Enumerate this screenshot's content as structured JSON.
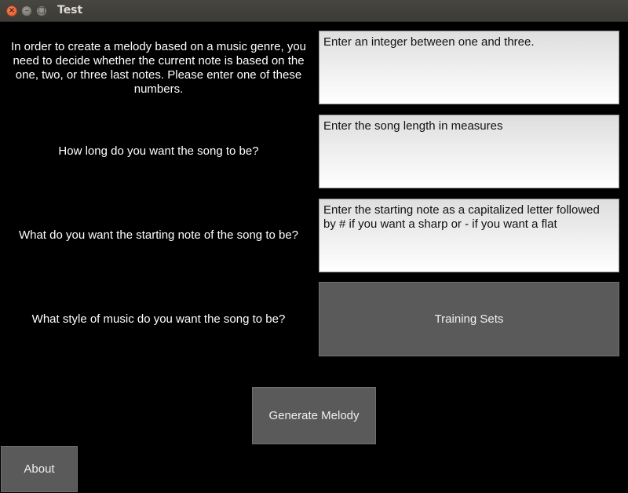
{
  "window": {
    "title": "Test",
    "close_glyph": "×",
    "minimize_glyph": "–",
    "maximize_glyph": "□"
  },
  "form": {
    "rows": [
      {
        "label": "In order to create a melody based on a music genre, you need to decide whether the current note is based on the one, two, or three last notes. Please enter one of these numbers.",
        "input_text": "Enter an integer between one and three."
      },
      {
        "label": "How long do you want the song to be?",
        "input_text": "Enter the song length in measures"
      },
      {
        "label": "What do you want the starting note of the song to be?",
        "input_text": "Enter the starting note as a capitalized letter followed by # if you want a sharp or - if you want a flat"
      }
    ],
    "style_label": "What style of music do you want the song to be?",
    "training_sets_button": "Training Sets"
  },
  "actions": {
    "generate_button": "Generate Melody",
    "about_button": "About"
  }
}
